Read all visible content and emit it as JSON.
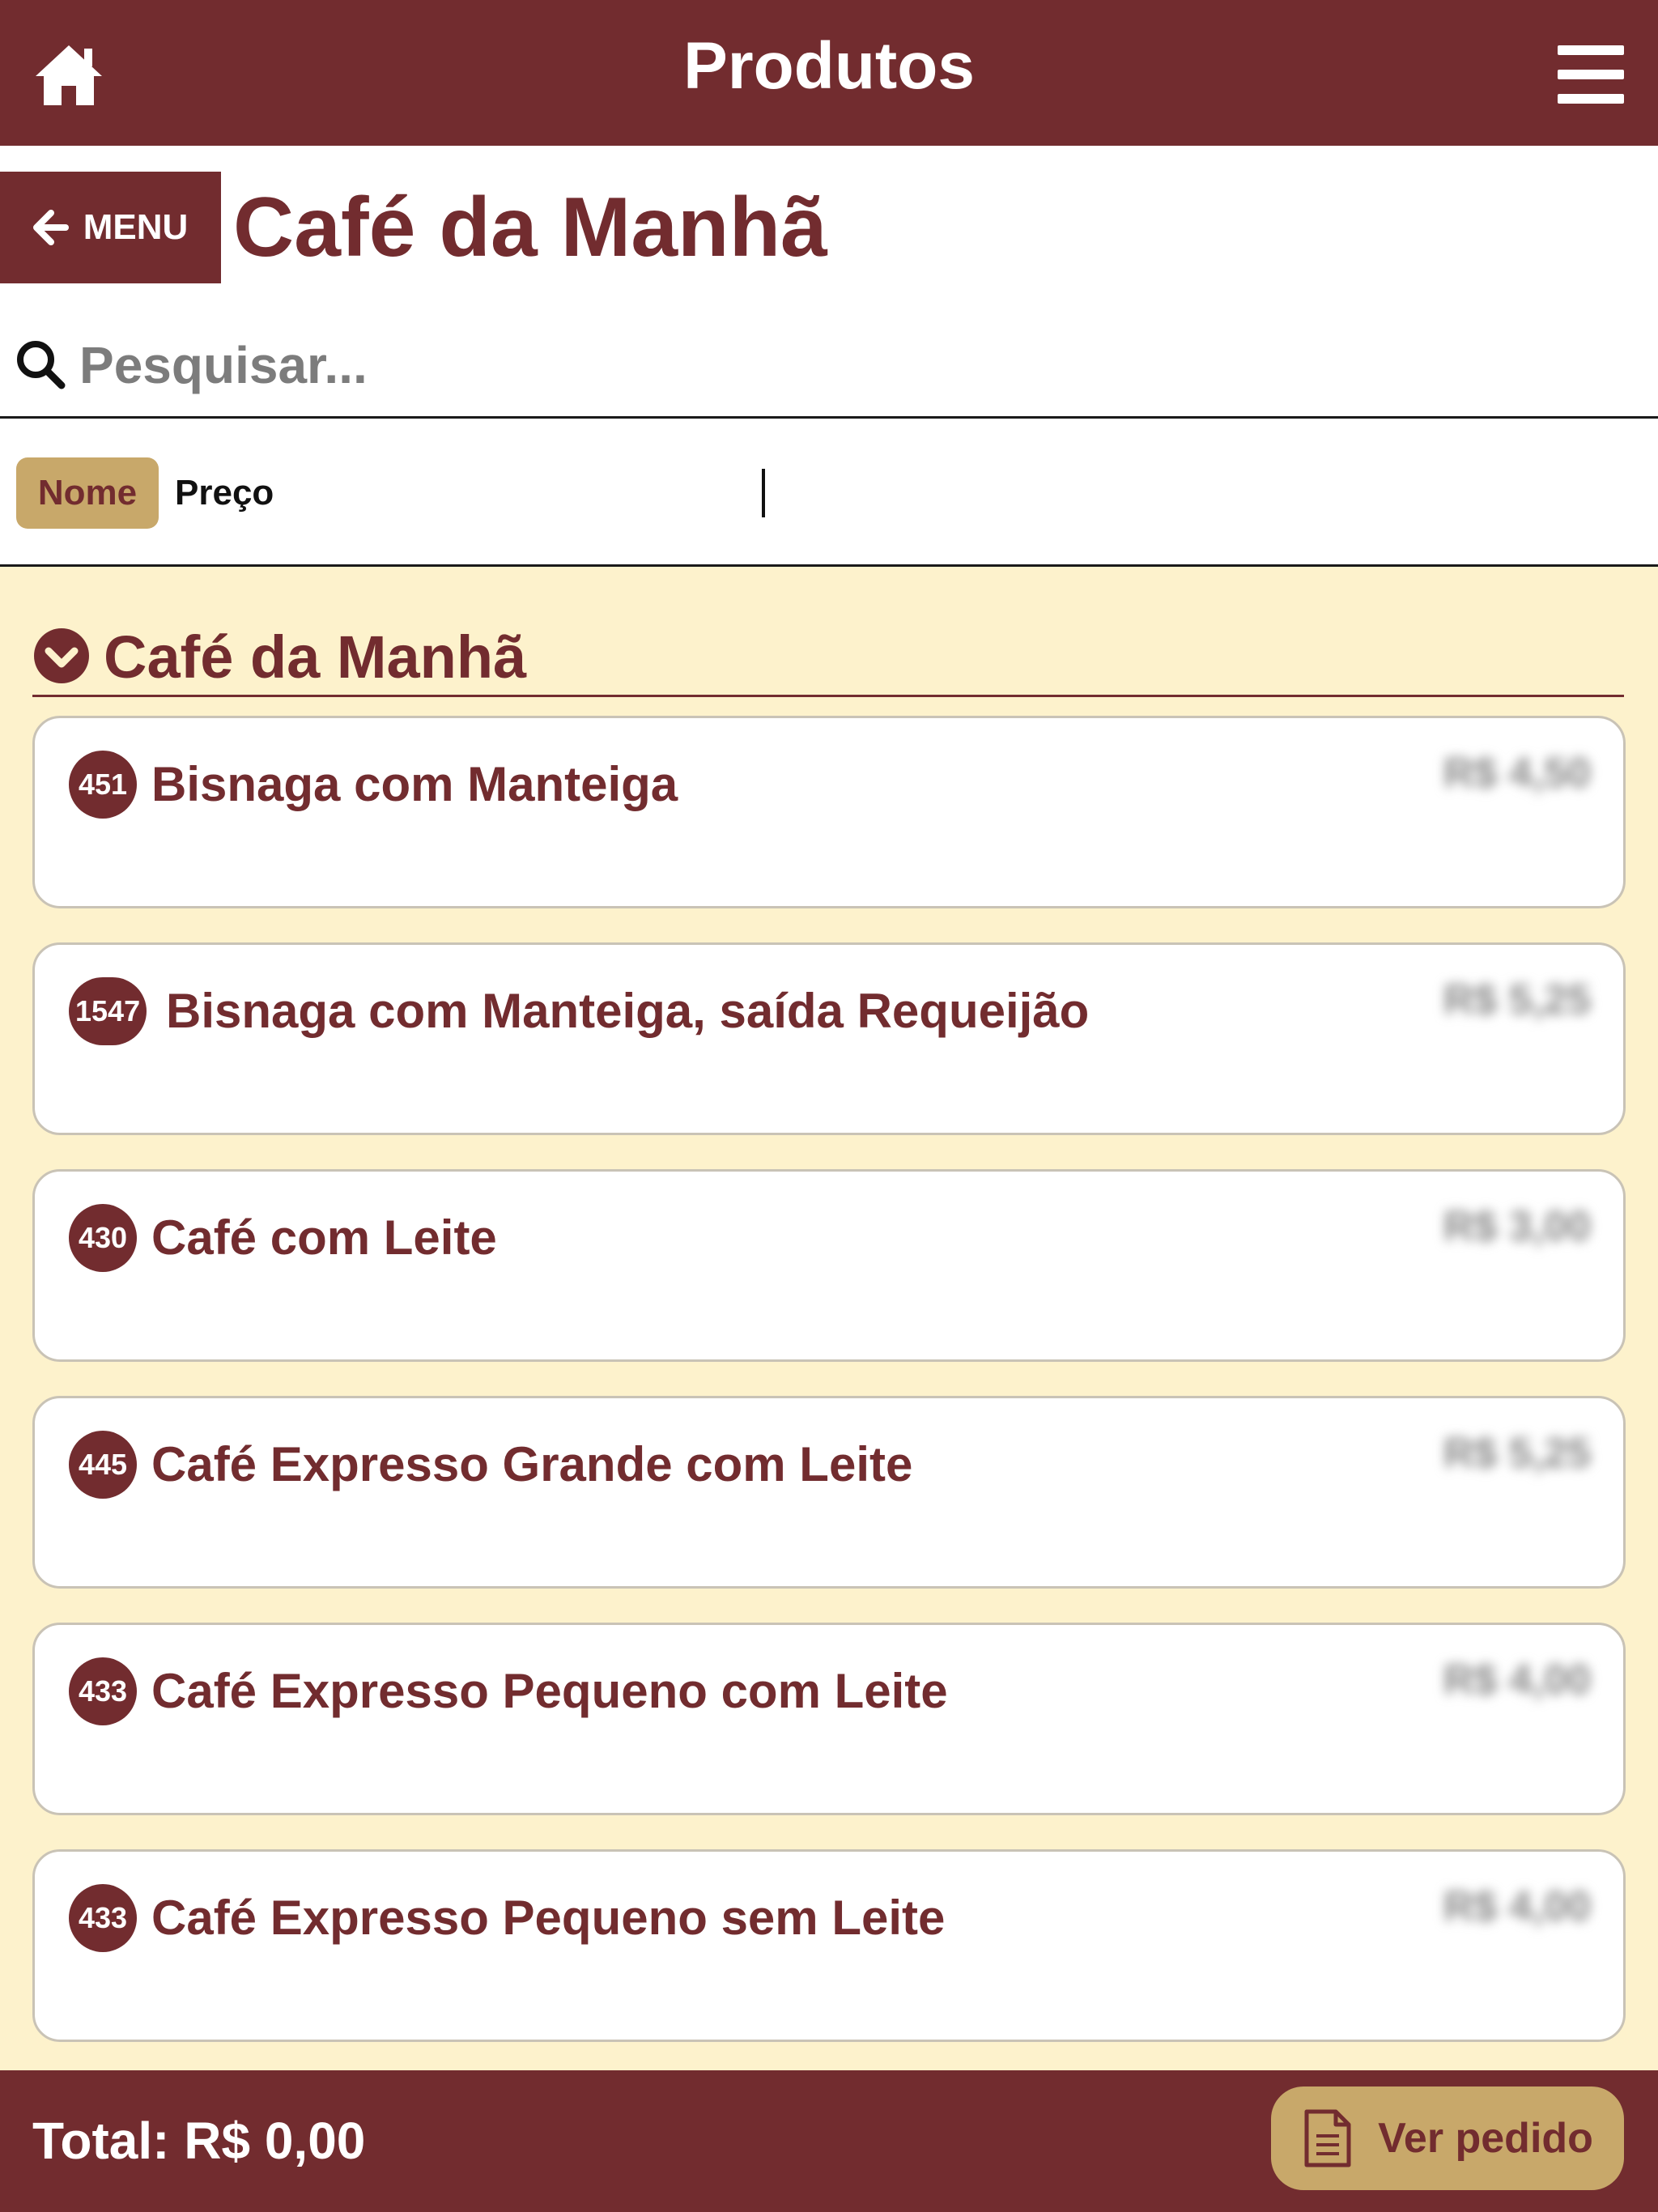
{
  "header": {
    "title": "Produtos",
    "home_icon": "home-icon",
    "menu_icon": "hamburger-icon"
  },
  "nav": {
    "back_label": "MENU",
    "back_icon": "arrow-left-icon"
  },
  "page": {
    "heading": "Café da Manhã"
  },
  "search": {
    "placeholder": "Pesquisar...",
    "value": "",
    "icon": "search-icon"
  },
  "sort": {
    "options": [
      "Nome",
      "Preço"
    ],
    "selected": "Nome"
  },
  "category": {
    "title": "Café da Manhã",
    "icon": "chevron-circle-down-icon",
    "expanded": true
  },
  "products": [
    {
      "code": "451",
      "name": "Bisnaga com Manteiga",
      "price": "R$ 4,50"
    },
    {
      "code": "1547",
      "name": "Bisnaga com Manteiga, saída Requeijão",
      "price": "R$ 5,25"
    },
    {
      "code": "430",
      "name": "Café com Leite",
      "price": "R$ 3,00"
    },
    {
      "code": "445",
      "name": "Café Expresso Grande com Leite",
      "price": "R$ 5,25"
    },
    {
      "code": "433",
      "name": "Café Expresso Pequeno com Leite",
      "price": "R$ 4,00"
    },
    {
      "code": "433",
      "name": "Café Expresso Pequeno sem Leite",
      "price": "R$ 4,00"
    }
  ],
  "footer": {
    "total_label": "Total: R$ 0,00",
    "order_button_label": "Ver pedido",
    "order_icon": "document-icon"
  },
  "colors": {
    "brand": "#722c2f",
    "accent": "#c8a86a",
    "background": "#fdf2cc"
  }
}
